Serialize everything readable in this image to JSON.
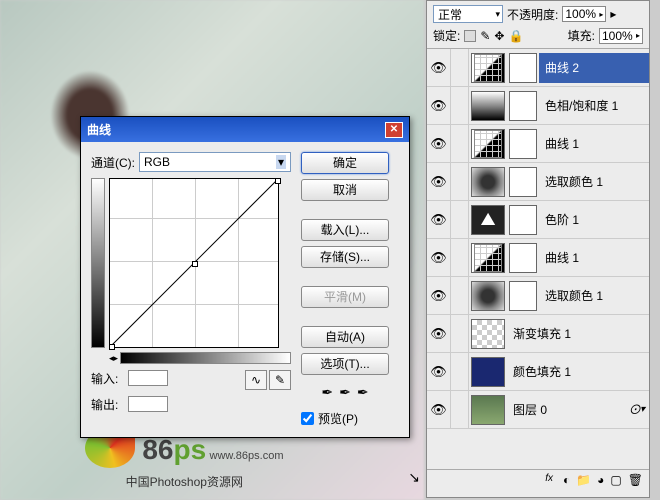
{
  "layersPanel": {
    "blendLabel": "正常",
    "opacityLabel": "不透明度:",
    "opacityValue": "100%",
    "lockLabel": "锁定:",
    "fillLabel": "填充:",
    "fillValue": "100%",
    "layers": [
      {
        "name": "曲线 2",
        "type": "curve",
        "selected": true
      },
      {
        "name": "色相/饱和度 1",
        "type": "hue"
      },
      {
        "name": "曲线 1",
        "type": "curve"
      },
      {
        "name": "选取颜色 1",
        "type": "selc"
      },
      {
        "name": "色阶 1",
        "type": "levels"
      },
      {
        "name": "曲线 1",
        "type": "curve"
      },
      {
        "name": "选取颜色 1",
        "type": "selc"
      },
      {
        "name": "渐变填充 1",
        "type": "grad",
        "noMask": true
      },
      {
        "name": "颜色填充 1",
        "type": "color",
        "noMask": true
      },
      {
        "name": "图层 0",
        "type": "img",
        "noMask": true,
        "fx": true
      }
    ]
  },
  "dialog": {
    "title": "曲线",
    "channelLabel": "通道(C):",
    "channelValue": "RGB",
    "inputLabel": "输入:",
    "outputLabel": "输出:",
    "buttons": {
      "ok": "确定",
      "cancel": "取消",
      "load": "载入(L)...",
      "save": "存储(S)...",
      "smooth": "平滑(M)",
      "auto": "自动(A)",
      "options": "选项(T)...",
      "preview": "预览(P)"
    }
  },
  "watermark": {
    "num": "86",
    "ps": "ps",
    "url": "www.86ps.com",
    "sub": "中国Photoshop资源网"
  }
}
